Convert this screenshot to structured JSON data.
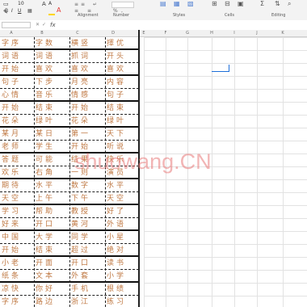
{
  "ribbon": {
    "font_size": "10",
    "captions": [
      "Alignment",
      "Number",
      "Styles",
      "Cells",
      "Editing"
    ],
    "accent_font_color": "#e53935",
    "fill_color": "#ffd500"
  },
  "formula_bar": {
    "name_box": "",
    "fx_label": "fx"
  },
  "columns": [
    "A",
    "B",
    "C",
    "D",
    "E",
    "F",
    "G",
    "H",
    "I",
    "J",
    "K"
  ],
  "table": {
    "rows": [
      [
        "字序",
        "字数",
        "横竖",
        "擇优"
      ],
      [
        "词语",
        "词语",
        "抓词",
        "开头"
      ],
      [
        "开始",
        "喜欢",
        "喜欢",
        "喜欢"
      ],
      [
        "句子",
        "下步",
        "月亮",
        "内容"
      ],
      [
        "心情",
        "音乐",
        "情感",
        "句子"
      ],
      [
        "开始",
        "结束",
        "开始",
        "结束"
      ],
      [
        "花朵",
        "绿叶",
        "花朵",
        "绿叶"
      ],
      [
        "某月",
        "某日",
        "第一",
        "天下"
      ],
      [
        "老师",
        "学生",
        "开始",
        "听说"
      ],
      [
        "答题",
        "可能",
        "结果",
        "快乐"
      ],
      [
        "欢乐",
        "右角",
        "一则",
        "演员"
      ],
      [
        "期待",
        "水平",
        "数字",
        "水平"
      ],
      [
        "天空",
        "上午",
        "下午",
        "天空"
      ],
      [
        "学习",
        "帮助",
        "教授",
        "好了"
      ],
      [
        "好来",
        "开口",
        "黄河",
        "外语"
      ],
      [
        "中国",
        "大学",
        "同学",
        "小星"
      ],
      [
        "开始",
        "结束",
        "超过",
        "绝对"
      ],
      [
        "小老",
        "开面",
        "开口",
        "读书"
      ],
      [
        "纸条",
        "文本",
        "外套",
        "小学"
      ],
      [
        "凉快",
        "你好",
        "手机",
        "根绩"
      ],
      [
        "字序",
        "路边",
        "浙江",
        "练习"
      ]
    ]
  },
  "watermark": "shuowang.CN"
}
